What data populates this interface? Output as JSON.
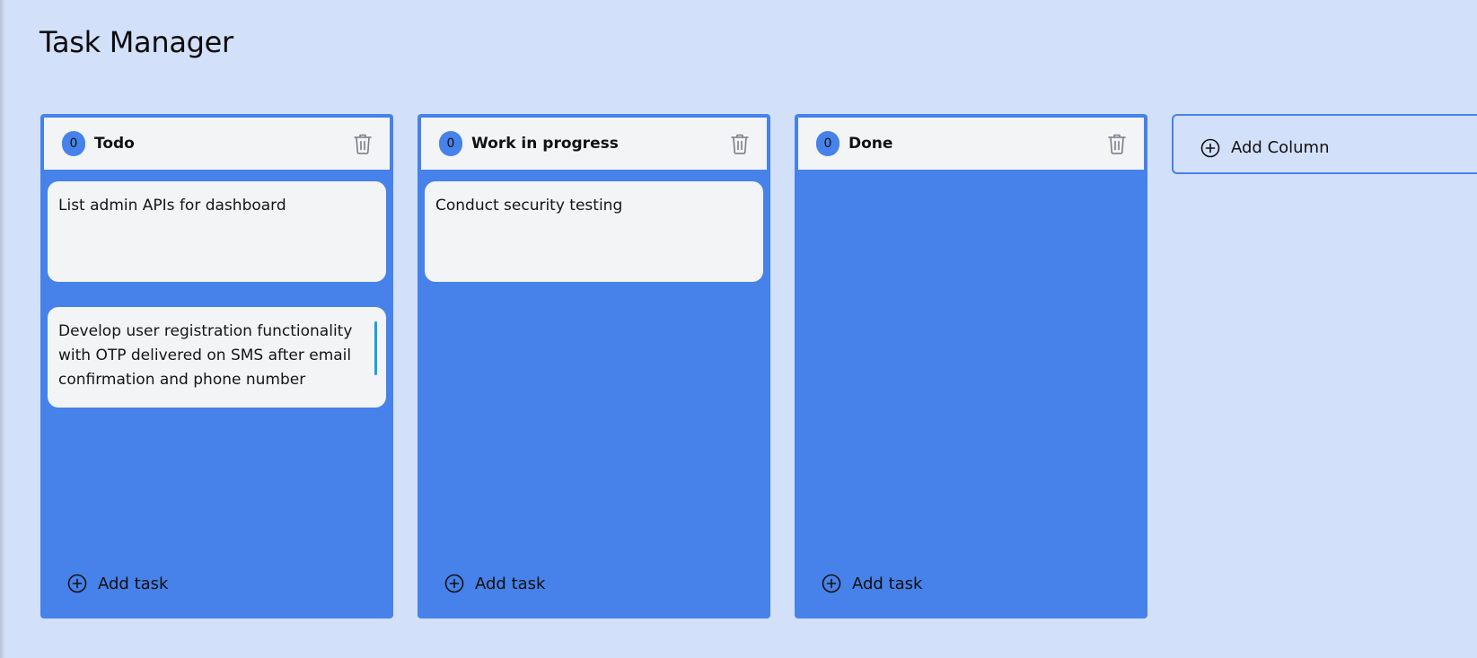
{
  "app": {
    "title": "Task Manager"
  },
  "colors": {
    "accent": "#4682e9",
    "card": "#f2f4f6",
    "background": "#d3e0fa"
  },
  "columns": [
    {
      "count": "0",
      "title": "Todo",
      "delete_icon": "trash-icon",
      "tasks": [
        {
          "text": "List admin APIs for dashboard"
        },
        {
          "text": "Develop user registration functionality with OTP delivered on SMS after email confirmation and phone number"
        }
      ],
      "add_task_label": "Add task"
    },
    {
      "count": "0",
      "title": "Work in progress",
      "delete_icon": "trash-icon",
      "tasks": [
        {
          "text": "Conduct security testing"
        }
      ],
      "add_task_label": "Add task"
    },
    {
      "count": "0",
      "title": "Done",
      "delete_icon": "trash-icon",
      "tasks": [],
      "add_task_label": "Add task"
    }
  ],
  "add_column": {
    "label": "Add Column",
    "icon": "plus-circle-icon"
  }
}
